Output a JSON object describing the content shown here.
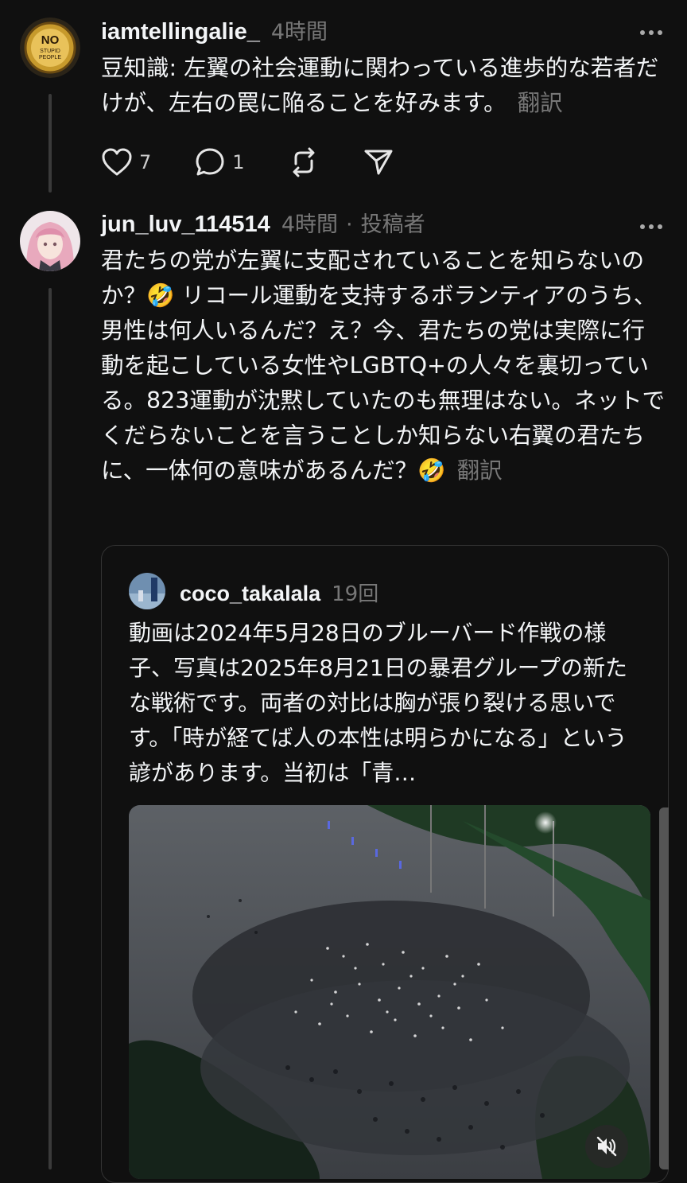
{
  "posts": [
    {
      "username": "iamtellingalie_",
      "time": "4時間",
      "avatar_text": [
        "NO",
        "STUPID",
        "PEOPLE"
      ],
      "text": "豆知識: 左翼の社会運動に関わっている進歩的な若者だけが、左右の罠に陥ることを好みます。",
      "translate": "翻訳",
      "likes": "7",
      "replies": "1"
    },
    {
      "username": "jun_luv_114514",
      "time": "4時間",
      "role": "投稿者",
      "text": "君たちの党が左翼に支配されていることを知らないのか？🤣 リコール運動を支持するボランティアのうち、男性は何人いるんだ？え？今、君たちの党は実際に行動を起こしている女性やLGBTQ+の人々を裏切っている。823運動が沈黙していたのも無理はない。ネットでくだらないことを言うことしか知らない右翼の君たちに、一体何の意味があるんだ？🤣",
      "translate": "翻訳"
    }
  ],
  "quote": {
    "username": "coco_takalala",
    "time": "19回",
    "text": "動画は2024年5月28日のブルーバード作戦の様子、写真は2025年8月21日の暴君グループの新たな戦術です。両者の対比は胸が張り裂ける思いです。「時が経てば人の本性は明らかになる」という諺があります。当初は「青…"
  },
  "icons": {
    "like": "heart-icon",
    "reply": "comment-icon",
    "repost": "repost-icon",
    "share": "share-icon",
    "more": "more-icon",
    "mute": "muted-speaker-icon"
  },
  "colors": {
    "background": "#101010",
    "text": "#f3f5f7",
    "muted": "#777777"
  }
}
